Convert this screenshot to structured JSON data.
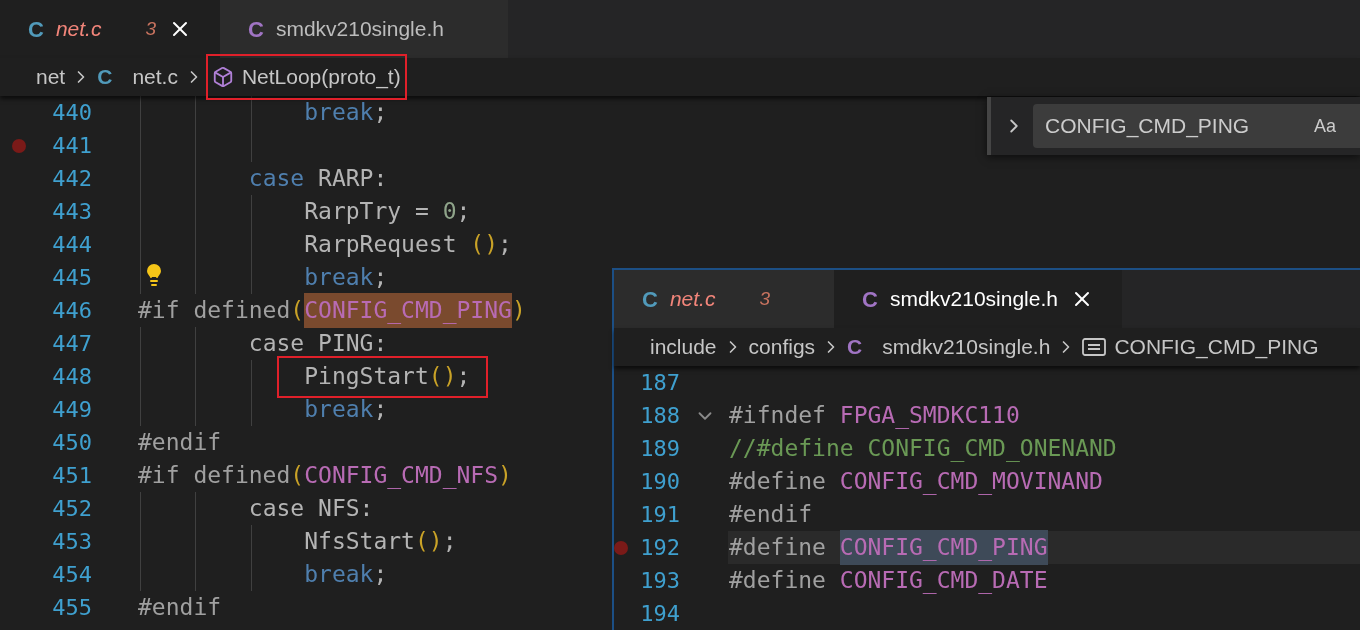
{
  "editor": {
    "tabs": [
      {
        "icon": "C",
        "color": "#519aba",
        "name": "net.c",
        "problems": "3",
        "has_errors": true,
        "selected": true
      },
      {
        "icon": "C",
        "color": "#a074c4",
        "name": "smdkv210single.h",
        "has_errors": false,
        "selected": false
      }
    ],
    "breadcrumbs": [
      {
        "kind": "folder",
        "text": "net"
      },
      {
        "kind": "file",
        "icon": "C",
        "color": "#519aba",
        "text": "net.c"
      },
      {
        "kind": "method",
        "text": "NetLoop(proto_t)",
        "annotated": true
      }
    ],
    "find": {
      "query": "CONFIG_CMD_PING",
      "option": "Aa"
    },
    "lines": [
      {
        "num": "440",
        "kind": "statement",
        "tokens": [
          {
            "kind": "kw",
            "text": "break"
          },
          {
            "kind": "plain",
            "text": ";"
          }
        ]
      },
      {
        "num": "441",
        "kind": "blank",
        "breakpoint": true
      },
      {
        "num": "442",
        "kind": "case",
        "tokens": [
          {
            "kind": "kw",
            "text": "case"
          },
          {
            "kind": "plain",
            "text": " RARP:"
          }
        ]
      },
      {
        "num": "443",
        "kind": "statement",
        "tokens": [
          {
            "kind": "plain",
            "text": "RarpTry = "
          },
          {
            "kind": "num",
            "text": "0"
          },
          {
            "kind": "plain",
            "text": ";"
          }
        ]
      },
      {
        "num": "444",
        "kind": "statement",
        "tokens": [
          {
            "kind": "plain",
            "text": "RarpRequest "
          },
          {
            "kind": "paren",
            "text": "()"
          },
          {
            "kind": "plain",
            "text": ";"
          }
        ]
      },
      {
        "num": "445",
        "kind": "statement",
        "lightbulb": true,
        "tokens": [
          {
            "kind": "kw",
            "text": "break"
          },
          {
            "kind": "plain",
            "text": ";"
          }
        ]
      },
      {
        "num": "446",
        "kind": "directive",
        "tokens": [
          {
            "kind": "pre",
            "text": "#if defined"
          },
          {
            "kind": "paren",
            "text": "("
          },
          {
            "kind": "macro",
            "text": "CONFIG_CMD_PING",
            "find_match": true
          },
          {
            "kind": "paren",
            "text": ")"
          }
        ]
      },
      {
        "num": "447",
        "kind": "case",
        "tokens": [
          {
            "kind": "plain",
            "text": "case PING:"
          }
        ]
      },
      {
        "num": "448",
        "kind": "statement",
        "boxed": true,
        "tokens": [
          {
            "kind": "plain",
            "text": "PingStart"
          },
          {
            "kind": "paren",
            "text": "()"
          },
          {
            "kind": "plain",
            "text": ";"
          }
        ]
      },
      {
        "num": "449",
        "kind": "statement",
        "tokens": [
          {
            "kind": "kw",
            "text": "break"
          },
          {
            "kind": "plain",
            "text": ";"
          }
        ]
      },
      {
        "num": "450",
        "kind": "directive",
        "tokens": [
          {
            "kind": "pre",
            "text": "#endif"
          }
        ]
      },
      {
        "num": "451",
        "kind": "directive",
        "tokens": [
          {
            "kind": "pre",
            "text": "#if defined"
          },
          {
            "kind": "paren",
            "text": "("
          },
          {
            "kind": "macro",
            "text": "CONFIG_CMD_NFS"
          },
          {
            "kind": "paren",
            "text": ")"
          }
        ]
      },
      {
        "num": "452",
        "kind": "case",
        "tokens": [
          {
            "kind": "plain",
            "text": "case NFS:"
          }
        ]
      },
      {
        "num": "453",
        "kind": "statement",
        "tokens": [
          {
            "kind": "plain",
            "text": "NfsStart"
          },
          {
            "kind": "paren",
            "text": "()"
          },
          {
            "kind": "plain",
            "text": ";"
          }
        ]
      },
      {
        "num": "454",
        "kind": "statement",
        "tokens": [
          {
            "kind": "kw",
            "text": "break"
          },
          {
            "kind": "plain",
            "text": ";"
          }
        ]
      },
      {
        "num": "455",
        "kind": "directive",
        "tokens": [
          {
            "kind": "pre",
            "text": "#endif"
          }
        ]
      }
    ]
  },
  "peek": {
    "tabs": [
      {
        "icon": "C",
        "color": "#519aba",
        "name": "net.c",
        "problems": "3",
        "has_errors": true,
        "selected": false
      },
      {
        "icon": "C",
        "color": "#a074c4",
        "name": "smdkv210single.h",
        "has_errors": false,
        "selected": true
      }
    ],
    "breadcrumbs": [
      {
        "kind": "folder",
        "text": "include"
      },
      {
        "kind": "folder",
        "text": "configs"
      },
      {
        "kind": "file",
        "icon": "C",
        "color": "#a074c4",
        "text": "smdkv210single.h"
      },
      {
        "kind": "constant",
        "text": "CONFIG_CMD_PING"
      }
    ],
    "lines": [
      {
        "num": "187",
        "kind": "blank"
      },
      {
        "num": "188",
        "kind": "directive",
        "foldable": true,
        "tokens": [
          {
            "kind": "pre",
            "text": "#ifndef "
          },
          {
            "kind": "macro",
            "text": "FPGA_SMDKC110"
          }
        ]
      },
      {
        "num": "189",
        "kind": "directive",
        "tokens": [
          {
            "kind": "comment",
            "text": "//#define CONFIG_CMD_ONENAND"
          }
        ]
      },
      {
        "num": "190",
        "kind": "directive",
        "tokens": [
          {
            "kind": "pre",
            "text": "#define "
          },
          {
            "kind": "macro",
            "text": "CONFIG_CMD_MOVINAND"
          }
        ]
      },
      {
        "num": "191",
        "kind": "directive",
        "tokens": [
          {
            "kind": "pre",
            "text": "#endif"
          }
        ]
      },
      {
        "num": "192",
        "kind": "directive",
        "breakpoint": true,
        "current": true,
        "tokens": [
          {
            "kind": "pre",
            "text": "#define "
          },
          {
            "kind": "macro",
            "text": "CONFIG_CMD_PING",
            "selected": true
          }
        ]
      },
      {
        "num": "193",
        "kind": "directive",
        "tokens": [
          {
            "kind": "pre",
            "text": "#define "
          },
          {
            "kind": "macro",
            "text": "CONFIG_CMD_DATE"
          }
        ]
      },
      {
        "num": "194",
        "kind": "blank"
      }
    ]
  }
}
